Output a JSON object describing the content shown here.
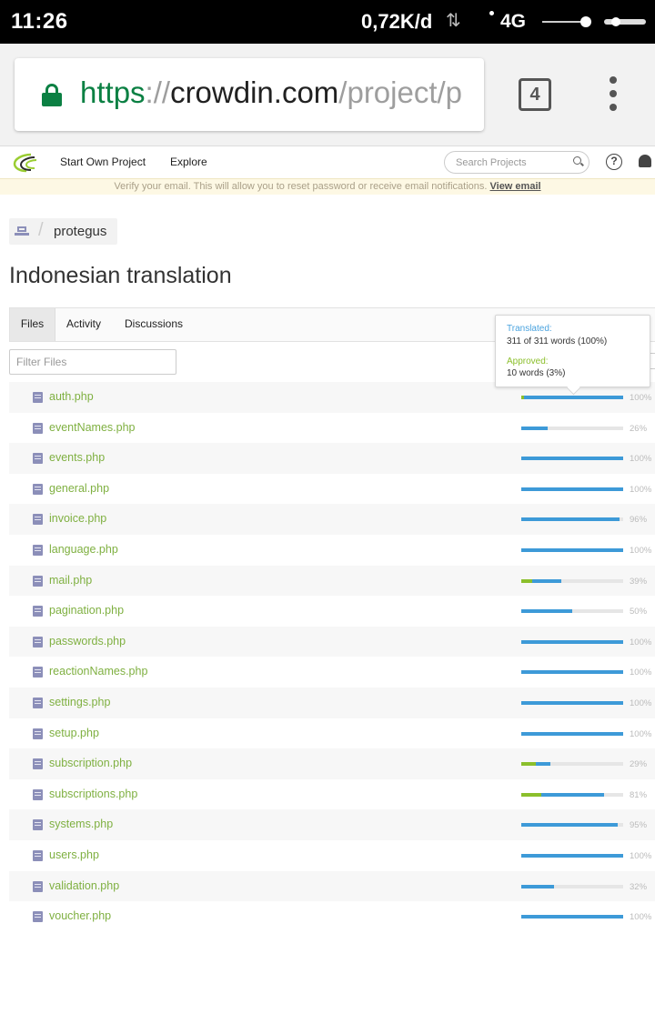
{
  "statusbar": {
    "time": "11:26",
    "speed": "0,72K/d",
    "network": "4G"
  },
  "browser": {
    "url_scheme": "https",
    "url_sep": "://",
    "url_host": "crowdin.com",
    "url_path": "/project/p",
    "tab_count": "4"
  },
  "header": {
    "nav": [
      "Start Own Project",
      "Explore"
    ],
    "search_placeholder": "Search Projects",
    "help": "?"
  },
  "verify_banner": {
    "text": "Verify your email. This will allow you to reset password or receive email notifications. ",
    "link": "View email"
  },
  "breadcrumb": {
    "project": "protegus"
  },
  "page_title": "Indonesian translation",
  "tabs": [
    {
      "label": "Files",
      "active": true
    },
    {
      "label": "Activity",
      "active": false
    },
    {
      "label": "Discussions",
      "active": false
    }
  ],
  "filter": {
    "placeholder": "Filter Files"
  },
  "tooltip": {
    "translated_label": "Translated:",
    "translated_value": "311 of 311 words (100%)",
    "approved_label": "Approved:",
    "approved_value": "10 words (3%)"
  },
  "files": [
    {
      "name": "auth.php",
      "translated": 100,
      "approved": 3,
      "pct": "100%"
    },
    {
      "name": "eventNames.php",
      "translated": 26,
      "approved": 0,
      "pct": "26%"
    },
    {
      "name": "events.php",
      "translated": 100,
      "approved": 0,
      "pct": "100%"
    },
    {
      "name": "general.php",
      "translated": 100,
      "approved": 0,
      "pct": "100%"
    },
    {
      "name": "invoice.php",
      "translated": 96,
      "approved": 0,
      "pct": "96%"
    },
    {
      "name": "language.php",
      "translated": 100,
      "approved": 0,
      "pct": "100%"
    },
    {
      "name": "mail.php",
      "translated": 39,
      "approved": 11,
      "pct": "39%"
    },
    {
      "name": "pagination.php",
      "translated": 50,
      "approved": 0,
      "pct": "50%"
    },
    {
      "name": "passwords.php",
      "translated": 100,
      "approved": 0,
      "pct": "100%"
    },
    {
      "name": "reactionNames.php",
      "translated": 100,
      "approved": 0,
      "pct": "100%"
    },
    {
      "name": "settings.php",
      "translated": 100,
      "approved": 0,
      "pct": "100%"
    },
    {
      "name": "setup.php",
      "translated": 100,
      "approved": 0,
      "pct": "100%"
    },
    {
      "name": "subscription.php",
      "translated": 29,
      "approved": 14,
      "pct": "29%"
    },
    {
      "name": "subscriptions.php",
      "translated": 81,
      "approved": 20,
      "pct": "81%"
    },
    {
      "name": "systems.php",
      "translated": 95,
      "approved": 0,
      "pct": "95%"
    },
    {
      "name": "users.php",
      "translated": 100,
      "approved": 0,
      "pct": "100%"
    },
    {
      "name": "validation.php",
      "translated": 32,
      "approved": 0,
      "pct": "32%"
    },
    {
      "name": "voucher.php",
      "translated": 100,
      "approved": 0,
      "pct": "100%"
    }
  ],
  "colors": {
    "translated_bar": "#3d9ad8",
    "approved_bar": "#8bbf2b",
    "file_link": "#7fb041",
    "secure_green": "#0b8043"
  }
}
